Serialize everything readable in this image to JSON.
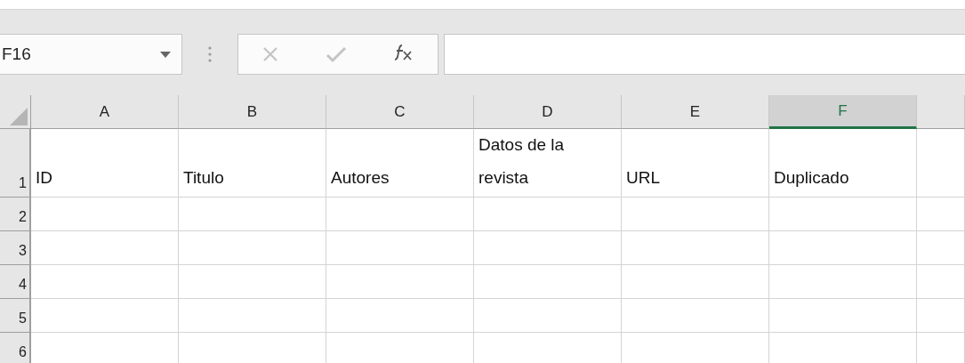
{
  "name_box": {
    "value": "F16"
  },
  "columns": [
    {
      "label": "A",
      "selected": false
    },
    {
      "label": "B",
      "selected": false
    },
    {
      "label": "C",
      "selected": false
    },
    {
      "label": "D",
      "selected": false
    },
    {
      "label": "E",
      "selected": false
    },
    {
      "label": "F",
      "selected": true
    },
    {
      "selected": false
    }
  ],
  "rows": [
    {
      "number": "1",
      "cells": [
        "ID",
        "Titulo",
        "Autores",
        "Datos de la\nrevista",
        "URL",
        "Duplicado"
      ]
    },
    {
      "number": "2"
    },
    {
      "number": "3"
    },
    {
      "number": "4"
    },
    {
      "number": "5"
    },
    {
      "number": "6"
    }
  ]
}
